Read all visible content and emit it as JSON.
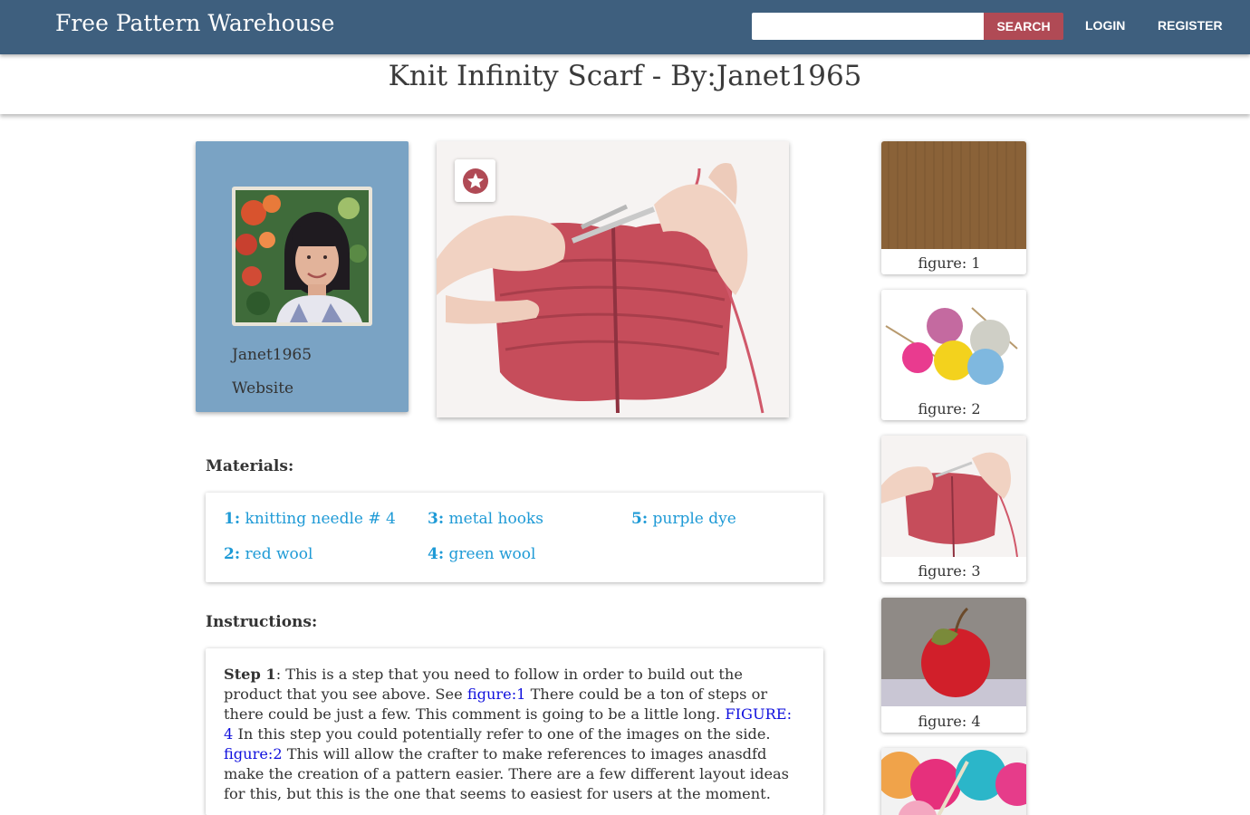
{
  "navbar": {
    "brand": "Free Pattern Warehouse",
    "search_placeholder": "",
    "search_label": "SEARCH",
    "login_label": "LOGIN",
    "register_label": "REGISTER"
  },
  "page": {
    "title": "Knit Infinity Scarf - By:Janet1965"
  },
  "profile": {
    "username": "Janet1965",
    "website_label": "Website"
  },
  "materials": {
    "heading": "Materials:",
    "items": [
      {
        "num": "1:",
        "name": "knitting needle # 4"
      },
      {
        "num": "2:",
        "name": "red wool"
      },
      {
        "num": "3:",
        "name": "metal hooks"
      },
      {
        "num": "4:",
        "name": "green wool"
      },
      {
        "num": "5:",
        "name": "purple dye"
      }
    ]
  },
  "instructions": {
    "heading": "Instructions:",
    "step_label": "Step 1",
    "part1": ": This is a step that you need to follow in order to build out the product that you see above. See ",
    "link1": "figure:1",
    "part2": " There could be a ton of steps or there could be just a few. This comment is going to be a little long. ",
    "link2": "FIGURE: 4",
    "part3": " In this step you could potentially refer to one of the images on the side. ",
    "link3": "figure:2",
    "part4": " This will allow the crafter to make references to images anasdfd make the creation of a pattern easier. There are a few different layout ideas for this, but this is the one that seems to easiest for users at the moment."
  },
  "figures": [
    {
      "caption": "figure: 1"
    },
    {
      "caption": "figure: 2"
    },
    {
      "caption": "figure: 3"
    },
    {
      "caption": "figure: 4"
    }
  ],
  "colors": {
    "navbar": "#3e5f7e",
    "search_button": "#b04a55",
    "profile_card": "#7aa3c4",
    "material_link": "#1e9ad6",
    "figure_link": "#1010dd"
  },
  "icons": {
    "favorite": "star-circle-icon"
  }
}
